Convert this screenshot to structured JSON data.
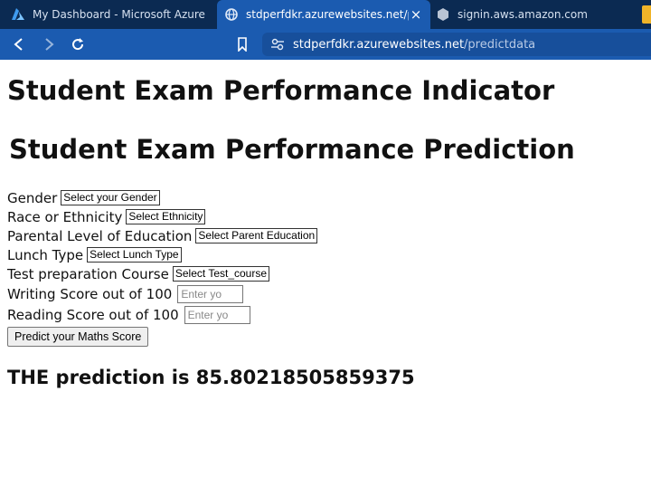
{
  "browser": {
    "tabs": [
      {
        "label": "My Dashboard - Microsoft Azure",
        "icon": "azure-logo-icon",
        "active": false
      },
      {
        "label": "stdperfdkr.azurewebsites.net/predictdata",
        "icon": "globe-icon",
        "active": true
      },
      {
        "label": "signin.aws.amazon.com",
        "icon": "hexagon-icon",
        "active": false
      }
    ],
    "url": {
      "domain": "stdperfdkr.azurewebsites.net",
      "path": "/predictdata"
    },
    "colors": {
      "tabbar": "#0b2a52",
      "toolbar": "#1b5bb0",
      "active_tab": "#1b5bb0"
    }
  },
  "page": {
    "heading1": "Student Exam Performance Indicator",
    "heading2": "Student Exam Performance Prediction",
    "form": {
      "gender": {
        "label": "Gender",
        "selected": "Select your Gender"
      },
      "ethnicity": {
        "label": "Race or Ethnicity",
        "selected": "Select Ethnicity"
      },
      "parent_education": {
        "label": "Parental Level of Education",
        "selected": "Select Parent Education"
      },
      "lunch": {
        "label": "Lunch Type",
        "selected": "Select Lunch Type"
      },
      "test_prep": {
        "label": "Test preparation Course",
        "selected": "Select Test_course"
      },
      "writing": {
        "label": "Writing Score out of 100",
        "placeholder": "Enter yo"
      },
      "reading": {
        "label": "Reading Score out of 100",
        "placeholder": "Enter yo"
      },
      "submit_label": "Predict your Maths Score"
    },
    "result": "THE prediction is 85.80218505859375"
  }
}
